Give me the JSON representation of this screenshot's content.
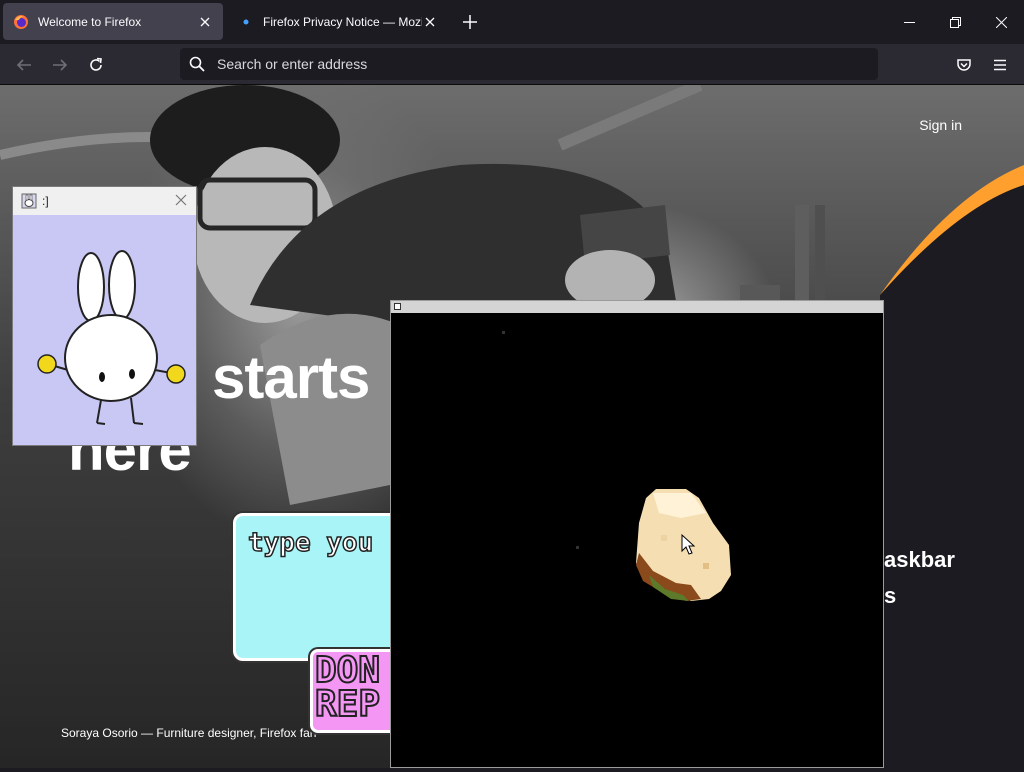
{
  "tabs": [
    {
      "title": "Welcome to Firefox",
      "active": true,
      "icon": "firefox-logo-icon"
    },
    {
      "title": "Firefox Privacy Notice — Mozilla",
      "active": false,
      "icon": "mozilla-icon"
    }
  ],
  "urlbar": {
    "placeholder": "Search or enter address"
  },
  "page": {
    "sign_in": "Sign in",
    "headline_line1": "starts",
    "headline_line2": "here",
    "right_line1": "askbar",
    "right_line2": "s",
    "caption": "Soraya Osorio — Furniture designer, Firefox fan",
    "accent_color": "#ff9f2e"
  },
  "bunny_window": {
    "title": ":]",
    "background": "#c9c8f4"
  },
  "bubble": {
    "text": "type you",
    "done_label": "DON\nREP"
  },
  "colors": {
    "titlebar": "#1c1b22",
    "toolbar": "#2b2a33",
    "active_tab": "#42414d"
  }
}
